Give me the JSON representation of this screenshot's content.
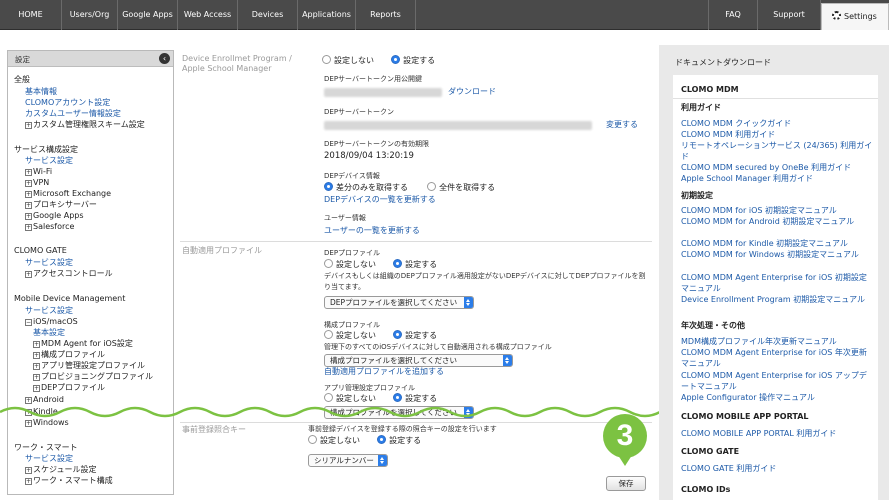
{
  "nav": {
    "home": "HOME",
    "users": "Users/Org",
    "google": "Google Apps",
    "web": "Web Access",
    "devices": "Devices",
    "applications": "Applications",
    "reports": "Reports",
    "faq": "FAQ",
    "support": "Support",
    "settings": "Settings"
  },
  "sidebar": {
    "header": "設定",
    "general": {
      "title": "全般",
      "items": [
        "基本情報",
        "CLOMOアカウント設定",
        "カスタムユーザー情報設定"
      ],
      "custom": "カスタム管理権限スキーム設定"
    },
    "service": {
      "title": "サービス構成設定",
      "link": "サービス設定",
      "items": [
        "Wi-Fi",
        "VPN",
        "Microsoft Exchange",
        "プロキシサーバー",
        "Google Apps",
        "Salesforce"
      ]
    },
    "gate": {
      "title": "CLOMO GATE",
      "link": "サービス設定",
      "item": "アクセスコントロール"
    },
    "mdm": {
      "title": "Mobile Device Management",
      "link": "サービス設定",
      "ios": "iOS/macOS",
      "basic": "基本設定",
      "sub": [
        "MDM Agent for iOS設定",
        "構成プロファイル",
        "アプリ管理設定プロファイル",
        "プロビジョニングプロファイル",
        "DEPプロファイル"
      ],
      "android": "Android",
      "kindle": "Kindle",
      "windows": "Windows"
    },
    "work": {
      "title": "ワーク・スマート",
      "link": "サービス設定",
      "items": [
        "スケジュール設定",
        "ワーク・スマート構成"
      ]
    }
  },
  "main": {
    "dep": {
      "label": "Device Enrollmet Program / Apple School Manager",
      "opt_off": "設定しない",
      "opt_on": "設定する",
      "pubkey_label": "DEPサーバートークン用公開鍵",
      "download": "ダウンロード",
      "token_label": "DEPサーバートークン",
      "change": "変更する",
      "expiry_label": "DEPサーバートークンの有効期限",
      "expiry": "2018/09/04 13:20:19",
      "devinfo_label": "DEPデバイス情報",
      "diff": "差分のみを取得する",
      "all": "全件を取得する",
      "devlist": "DEPデバイスの一覧を更新する",
      "userinfo_label": "ユーザー情報",
      "userlist": "ユーザーの一覧を更新する"
    },
    "auto": {
      "label": "自動適用プロファイル",
      "dep_label": "DEPプロファイル",
      "dep_desc": "デバイスもしくは組織のDEPプロファイル適用設定がないDEPデバイスに対してDEPプロファイルを割り当てます。",
      "dep_select": "DEPプロファイルを選択してください",
      "conf_label": "構成プロファイル",
      "conf_desc": "管理下のすべてのiOSデバイスに対して自動適用される構成プロファイル",
      "conf_select": "構成プロファイルを選択してください",
      "conf_add": "自動適用プロファイルを追加する",
      "app_label": "アプリ管理設定プロファイル",
      "app_select": "構成プロファイルを選択してください",
      "opt_off": "設定しない",
      "opt_on": "設定する"
    },
    "preauth": {
      "label": "事前登録照合キー",
      "desc": "事前登録デバイスを登録する際の照合キーの設定を行います",
      "opt_off": "設定しない",
      "opt_on": "設定する",
      "select": "シリアルナンバー"
    },
    "save": "保存",
    "step": "3"
  },
  "docs": {
    "title": "ドキュメントダウンロード",
    "mdm_head": "CLOMO MDM",
    "guide_head": "利用ガイド",
    "guides": [
      "CLOMO MDM クイックガイド",
      "CLOMO MDM 利用ガイド",
      "リモートオペレーションサービス (24/365) 利用ガイド",
      "CLOMO MDM secured by OneBe 利用ガイド",
      "Apple School Manager 利用ガイド"
    ],
    "init_head": "初期設定",
    "inits": [
      "CLOMO MDM for iOS 初期設定マニュアル",
      "CLOMO MDM for Android 初期設定マニュアル",
      "CLOMO MDM for Kindle 初期設定マニュアル",
      "CLOMO MDM for Windows 初期設定マニュアル",
      "CLOMO MDM Agent Enterprise for iOS 初期設定マニュアル",
      "Device Enrollment Program 初期設定マニュアル"
    ],
    "year_head": "年次処理・その他",
    "years": [
      "MDM構成プロファイル年次更新マニュアル",
      "CLOMO MDM Agent Enterprise for iOS 年次更新マニュアル",
      "CLOMO MDM Agent Enterprise for iOS アップデートマニュアル",
      "Apple Configurator 操作マニュアル"
    ],
    "portal_head": "CLOMO MOBILE APP PORTAL",
    "portal_link": "CLOMO MOBILE APP PORTAL 利用ガイド",
    "gate_head": "CLOMO GATE",
    "gate_link": "CLOMO GATE 利用ガイド",
    "ids_head": "CLOMO IDs"
  }
}
